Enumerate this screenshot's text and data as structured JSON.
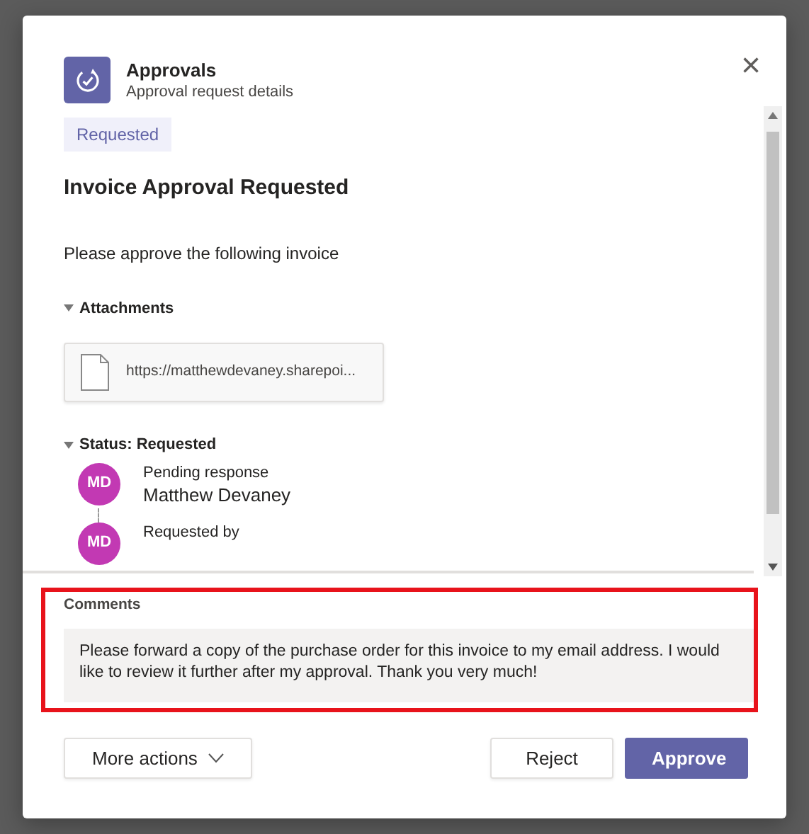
{
  "dialog": {
    "app_name": "Approvals",
    "subtitle": "Approval request details",
    "close": "×"
  },
  "status_tag": "Requested",
  "title": "Invoice Approval Requested",
  "description": "Please approve the following invoice",
  "attachments": {
    "heading": "Attachments",
    "expanded": true,
    "files": [
      "https://matthewdevaney.sharepoi..."
    ]
  },
  "status": {
    "heading": "Status: Requested",
    "expanded": true,
    "entries": [
      {
        "initials": "MD",
        "label": "Pending response",
        "name": "Matthew Devaney"
      },
      {
        "initials": "MD",
        "label": "Requested by"
      }
    ]
  },
  "comments": {
    "label": "Comments",
    "text": "Please forward a copy of the purchase order for this invoice to my email address. I would like to review it further after my approval. Thank you very much!",
    "highlighted": true
  },
  "buttons": [
    {
      "label": "More actions",
      "kind": "dropdown"
    },
    {
      "label": "Reject",
      "kind": "secondary"
    },
    {
      "label": "Approve",
      "kind": "primary"
    }
  ]
}
